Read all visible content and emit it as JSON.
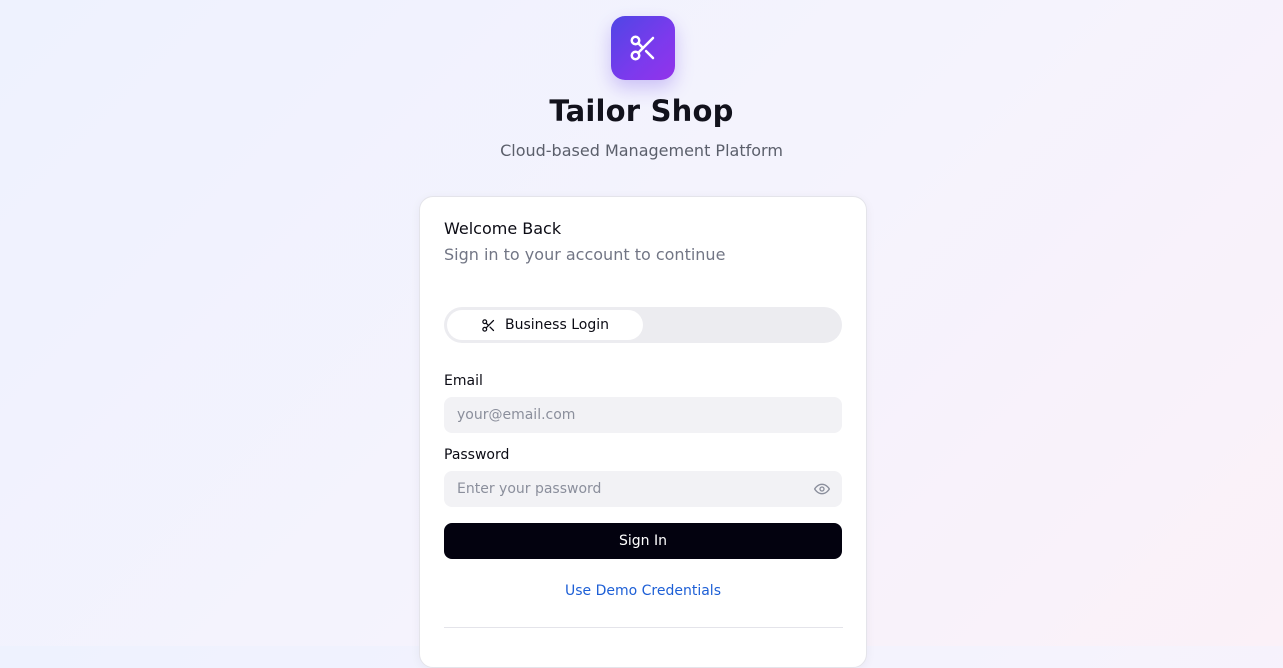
{
  "header": {
    "logo_icon": "scissors-icon",
    "title": "Tailor Shop",
    "subtitle": "Cloud-based Management Platform",
    "accent_gradient": [
      "#4f46e5",
      "#9333ea"
    ]
  },
  "card": {
    "title": "Welcome Back",
    "subtitle": "Sign in to your account to continue",
    "tabs": [
      {
        "label": "Business Login",
        "icon": "scissors-icon",
        "active": true
      }
    ],
    "email": {
      "label": "Email",
      "placeholder": "your@email.com",
      "value": ""
    },
    "password": {
      "label": "Password",
      "placeholder": "Enter your password",
      "value": "",
      "toggle_icon": "eye-icon"
    },
    "signin_label": "Sign In",
    "demo_label": "Use Demo Credentials"
  },
  "colors": {
    "primary_button": "#03020f",
    "link": "#1d5fd6",
    "input_bg": "#f2f2f5"
  }
}
